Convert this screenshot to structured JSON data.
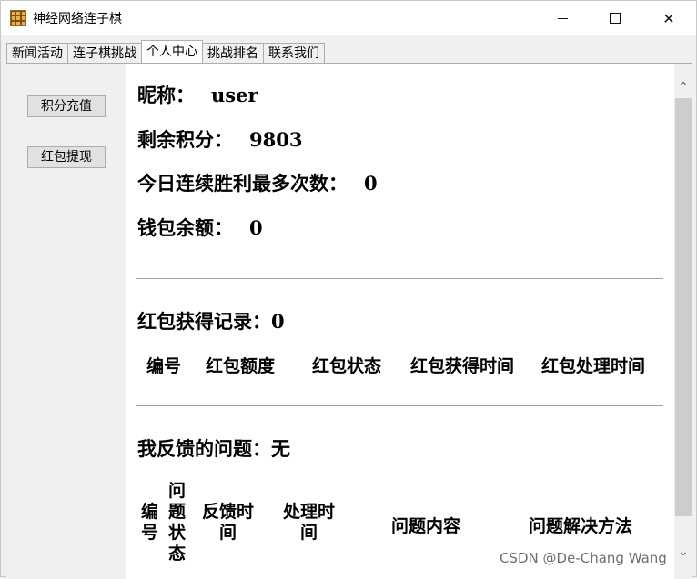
{
  "window": {
    "title": "神经网络连子棋",
    "minimize_icon": "minimize-icon",
    "maximize_icon": "maximize-icon",
    "close_symbol": "✕"
  },
  "tabs": [
    {
      "label": "新闻活动",
      "active": false
    },
    {
      "label": "连子棋挑战",
      "active": false
    },
    {
      "label": "个人中心",
      "active": true
    },
    {
      "label": "挑战排名",
      "active": false
    },
    {
      "label": "联系我们",
      "active": false
    }
  ],
  "sidebar": {
    "recharge_label": "积分充值",
    "withdraw_label": "红包提现"
  },
  "profile": {
    "nickname_label": "昵称：",
    "nickname_value": "user",
    "points_label": "剩余积分：",
    "points_value": "9803",
    "streak_label": "今日连续胜利最多次数：",
    "streak_value": "0",
    "wallet_label": "钱包余额：",
    "wallet_value": "0"
  },
  "redpacket": {
    "title": "红包获得记录：0",
    "columns": [
      "编号",
      "红包额度",
      "红包状态",
      "红包获得时间",
      "红包处理时间"
    ]
  },
  "feedback": {
    "title": "我反馈的问题：无",
    "columns": {
      "id": [
        "编",
        "号"
      ],
      "status": [
        "问",
        "题",
        "状",
        "态"
      ],
      "feedback_time": [
        "反馈时",
        "间"
      ],
      "process_time": [
        "处理时",
        "间"
      ],
      "content": "问题内容",
      "solution": "问题解决方法"
    }
  },
  "scrollbar": {
    "up_symbol": "⌃",
    "down_symbol": "⌄"
  },
  "watermark": "CSDN @De-Chang Wang"
}
